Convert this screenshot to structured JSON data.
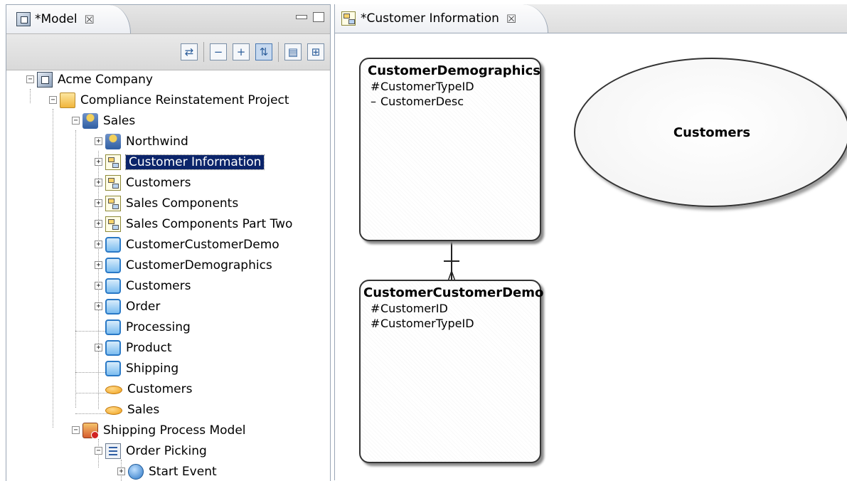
{
  "model_view": {
    "tab_title": "*Model",
    "close_glyph": "☒",
    "tree": [
      {
        "label": "Acme Company",
        "icon": "company-icon"
      },
      {
        "label": "Compliance Reinstatement  Project",
        "icon": "folder-icon"
      },
      {
        "label": "Sales",
        "icon": "sales-icon"
      },
      {
        "label": "Northwind",
        "icon": "sales-icon"
      },
      {
        "label": "Customer Information",
        "icon": "diagram-icon",
        "selected": true
      },
      {
        "label": "Customers",
        "icon": "diagram-icon"
      },
      {
        "label": "Sales Components",
        "icon": "diagram-icon"
      },
      {
        "label": "Sales Components Part Two",
        "icon": "diagram-icon"
      },
      {
        "label": "CustomerCustomerDemo",
        "icon": "entity-icon"
      },
      {
        "label": "CustomerDemographics",
        "icon": "entity-icon"
      },
      {
        "label": "Customers",
        "icon": "entity-icon"
      },
      {
        "label": "Order",
        "icon": "entity-icon"
      },
      {
        "label": "Processing",
        "icon": "entity-icon"
      },
      {
        "label": "Product",
        "icon": "entity-icon"
      },
      {
        "label": "Shipping",
        "icon": "entity-icon"
      },
      {
        "label": "Customers",
        "icon": "topic-icon"
      },
      {
        "label": "Sales",
        "icon": "topic-icon"
      },
      {
        "label": "Shipping Process Model",
        "icon": "process-icon"
      },
      {
        "label": "Order Picking",
        "icon": "flow-icon"
      },
      {
        "label": "Start Event",
        "icon": "event-icon"
      }
    ]
  },
  "editor": {
    "tab_title": "*Customer Information",
    "close_glyph": "☒",
    "entities": [
      {
        "name": "CustomerDemographics",
        "attributes": [
          {
            "mark": "#",
            "name": "CustomerTypeID"
          },
          {
            "mark": "–",
            "name": "CustomerDesc"
          }
        ]
      },
      {
        "name": "CustomerCustomerDemo",
        "attributes": [
          {
            "mark": "#",
            "name": "CustomerID"
          },
          {
            "mark": "#",
            "name": "CustomerTypeID"
          }
        ]
      }
    ],
    "topic": {
      "name": "Customers"
    }
  }
}
